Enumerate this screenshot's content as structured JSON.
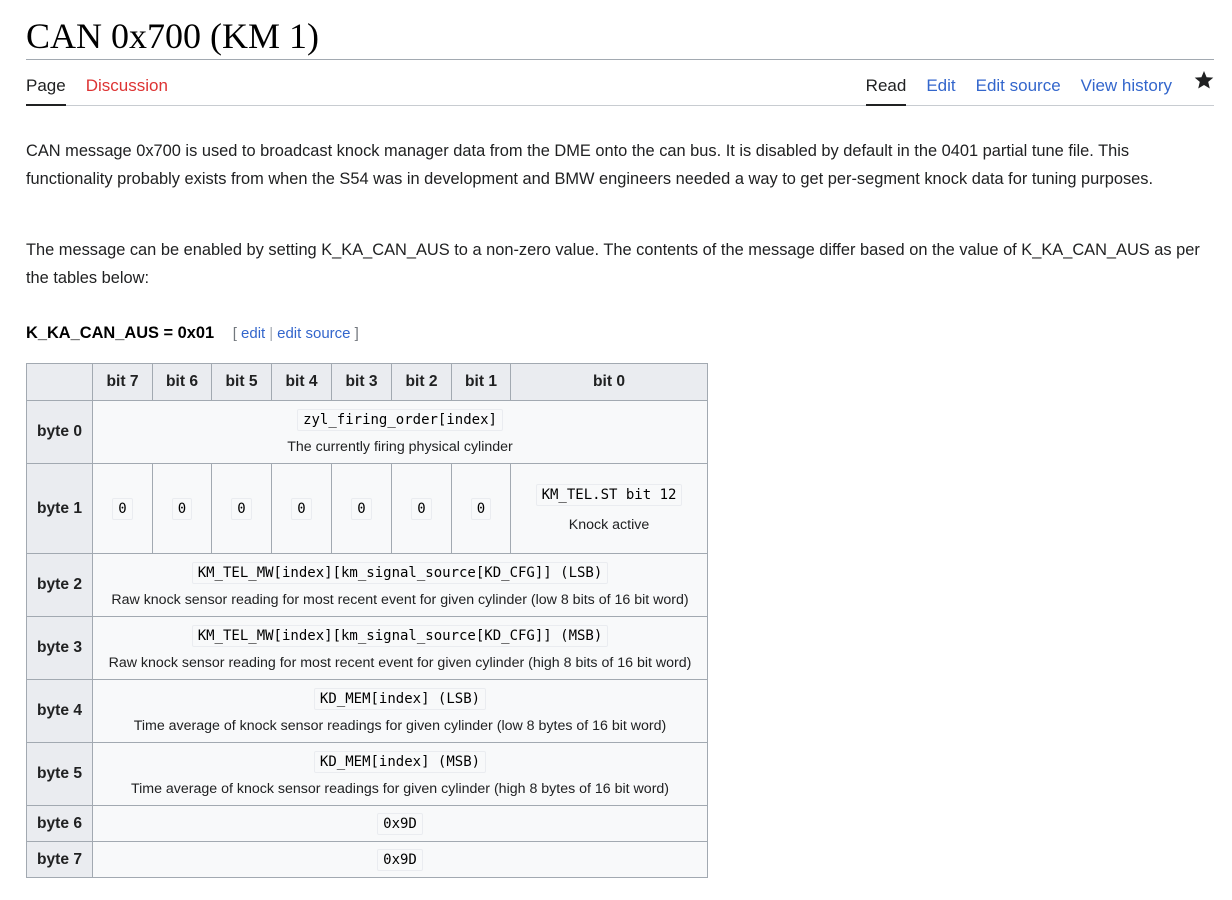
{
  "page": {
    "title": "CAN 0x700 (KM 1)",
    "tabs_left": [
      {
        "label": "Page",
        "selected": true
      },
      {
        "label": "Discussion",
        "selected": false
      }
    ],
    "tabs_right": [
      {
        "label": "Read",
        "selected": true
      },
      {
        "label": "Edit",
        "selected": false
      },
      {
        "label": "Edit source",
        "selected": false
      },
      {
        "label": "View history",
        "selected": false
      }
    ],
    "watch_icon": "star-icon"
  },
  "content": {
    "paragraph1": "CAN message 0x700 is used to broadcast knock manager data from the DME onto the can bus. It is disabled by default in the 0401 partial tune file. This functionality probably exists from when the S54 was in development and BMW engineers needed a way to get per-segment knock data for tuning purposes.",
    "paragraph2": "The message can be enabled by setting K_KA_CAN_AUS to a non-zero value. The contents of the message differ based on the value of K_KA_CAN_AUS as per the tables below:",
    "section": {
      "title": "K_KA_CAN_AUS = 0x01",
      "bracket_open": "[",
      "edit_label": "edit",
      "separator": "|",
      "edit_source_label": "edit source",
      "bracket_close": "]"
    }
  },
  "table": {
    "headers": [
      "bit 7",
      "bit 6",
      "bit 5",
      "bit 4",
      "bit 3",
      "bit 2",
      "bit 1",
      "bit 0"
    ],
    "rows": [
      {
        "label": "byte 0",
        "code": "zyl_firing_order[index]",
        "desc": "The currently firing physical cylinder"
      },
      {
        "label": "byte 1",
        "bits": [
          "0",
          "0",
          "0",
          "0",
          "0",
          "0",
          "0"
        ],
        "bit0_code": "KM_TEL.ST bit 12",
        "bit0_desc": "Knock active"
      },
      {
        "label": "byte 2",
        "code": "KM_TEL_MW[index][km_signal_source[KD_CFG]] (LSB)",
        "desc": "Raw knock sensor reading for most recent event for given cylinder (low 8 bits of 16 bit word)"
      },
      {
        "label": "byte 3",
        "code": "KM_TEL_MW[index][km_signal_source[KD_CFG]] (MSB)",
        "desc": "Raw knock sensor reading for most recent event for given cylinder (high 8 bits of 16 bit word)"
      },
      {
        "label": "byte 4",
        "code": "KD_MEM[index] (LSB)",
        "desc": "Time average of knock sensor readings for given cylinder (low 8 bytes of 16 bit word)"
      },
      {
        "label": "byte 5",
        "code": "KD_MEM[index] (MSB)",
        "desc": "Time average of knock sensor readings for given cylinder (high 8 bytes of 16 bit word)"
      },
      {
        "label": "byte 6",
        "code": "0x9D"
      },
      {
        "label": "byte 7",
        "code": "0x9D"
      }
    ]
  }
}
